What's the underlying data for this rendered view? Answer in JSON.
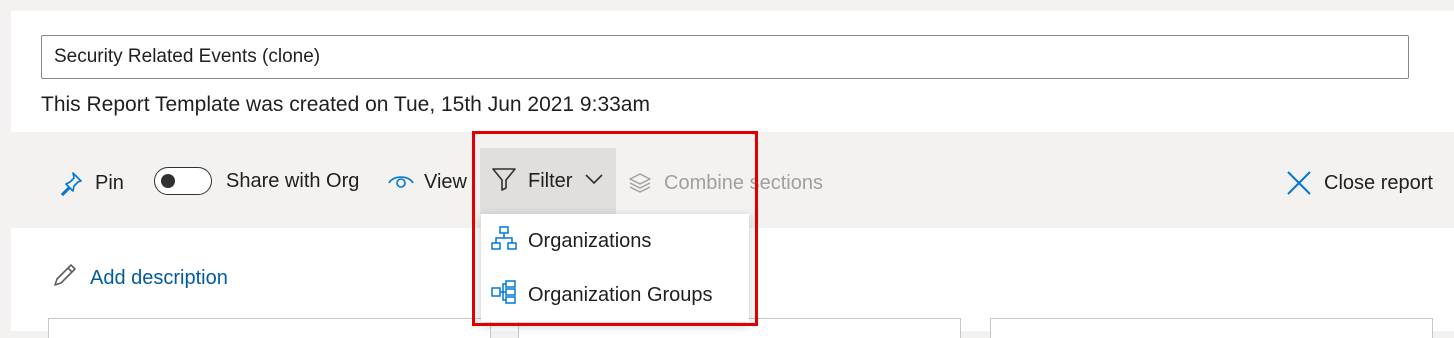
{
  "report": {
    "title_value": "Security Related Events (clone)",
    "created_text": "This Report Template was created on Tue, 15th Jun 2021 9:33am"
  },
  "toolbar": {
    "pin_label": "Pin",
    "share_label": "Share with Org",
    "share_enabled": false,
    "view_label": "View",
    "filter_label": "Filter",
    "combine_label": "Combine sections",
    "close_label": "Close report"
  },
  "filter_menu": {
    "items": [
      {
        "label": "Organizations",
        "icon": "org-chart-icon"
      },
      {
        "label": "Organization Groups",
        "icon": "org-groups-icon"
      }
    ]
  },
  "body": {
    "add_description_label": "Add description"
  },
  "colors": {
    "accent": "#005a9e",
    "highlight_border": "#e00000",
    "toolbar_bg": "#f3f2f1",
    "filter_active_bg": "#e1dfdd"
  }
}
